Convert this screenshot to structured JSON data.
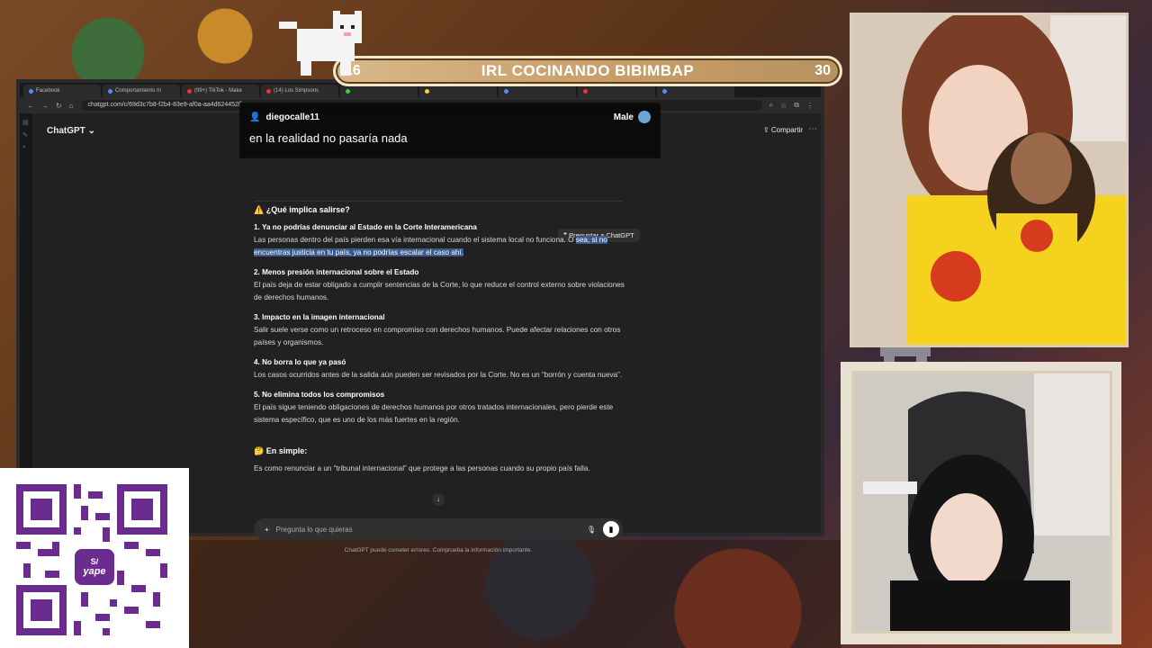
{
  "stream": {
    "title": "IRL COCINANDO BIBIMBAP",
    "left_count": "16",
    "right_count": "30"
  },
  "browser": {
    "tabs": [
      "Facebook",
      "Comportamiento m",
      "(99+) TikTok - Make",
      "(14) Los Simpsons",
      "",
      "",
      "",
      "",
      ""
    ],
    "url": "chatgpt.com/c/69d3c7b8-f2b4-83e9-af0a-aa4d624452ff"
  },
  "app": {
    "model_label": "ChatGPT",
    "share_label": "Compartir",
    "ask_gpt_label": "Preguntar a ChatGPT",
    "heading": "⚠️ ¿Qué implica salirse?",
    "points": [
      {
        "title": "1. Ya no podrías denunciar al Estado en la Corte Interamericana",
        "body_a": "Las personas dentro del país pierden esa vía internacional cuando el sistema local no funciona. O",
        "body_hl": "sea, si no encuentras justicia en tu país, ya no podrías escalar el caso ahí."
      },
      {
        "title": "2. Menos presión internacional sobre el Estado",
        "body": "El país deja de estar obligado a cumplir sentencias de la Corte, lo que reduce el control externo sobre violaciones de derechos humanos."
      },
      {
        "title": "3. Impacto en la imagen internacional",
        "body": "Salir suele verse como un retroceso en compromiso con derechos humanos. Puede afectar relaciones con otros países y organismos."
      },
      {
        "title": "4. No borra lo que ya pasó",
        "body": "Los casos ocurridos antes de la salida aún pueden ser revisados por la Corte. No es un “borrón y cuenta nueva”."
      },
      {
        "title": "5. No elimina todos los compromisos",
        "body": "El país sigue teniendo obligaciones de derechos humanos por otros tratados internacionales, pero pierde este sistema específico, que es uno de los más fuertes en la región."
      }
    ],
    "summary_heading": "🤔 En simple:",
    "summary_body": "Es como renunciar a un “tribunal internacional” que protege a las personas cuando su propio país falla.",
    "composer_placeholder": "Pregunta lo que quieras",
    "disclaimer": "ChatGPT puede cometer errores. Comprueba la información importante."
  },
  "overlay": {
    "username": "diegocalle11",
    "message": "en la realidad no pasaría nada",
    "badge": "Male"
  },
  "qr": {
    "brand": "yape",
    "currency": "S/"
  }
}
